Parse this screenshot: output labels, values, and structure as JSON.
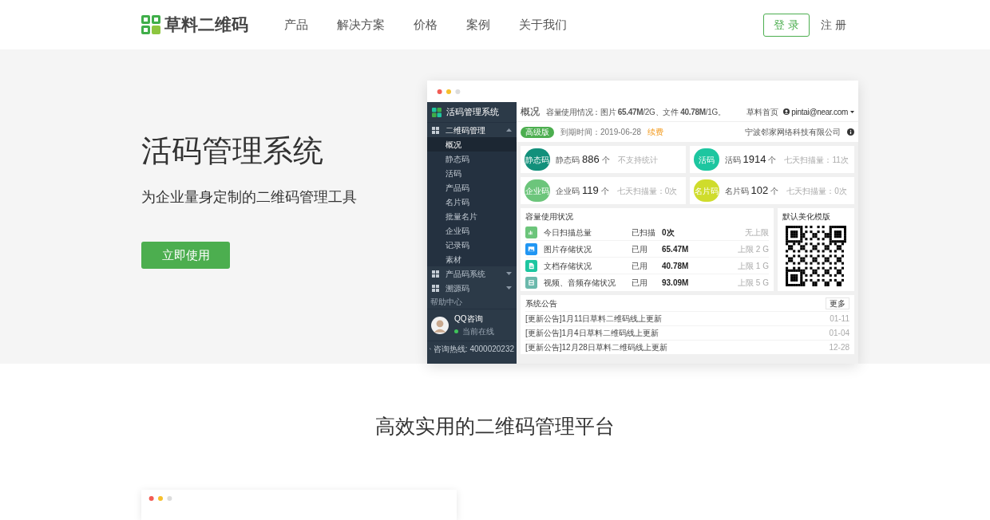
{
  "header": {
    "logo": "草料二维码",
    "nav": [
      {
        "label": "产品"
      },
      {
        "label": "解决方案"
      },
      {
        "label": "价格"
      },
      {
        "label": "案例"
      },
      {
        "label": "关于我们"
      }
    ],
    "login": "登 录",
    "register": "注 册"
  },
  "hero": {
    "title": "活码管理系统",
    "subtitle": "为企业量身定制的二维码管理工具",
    "cta": "立即使用"
  },
  "mockup": {
    "sidebar": {
      "title": "活码管理系统",
      "groups": [
        {
          "label": "二维码管理",
          "expanded": true,
          "children": [
            {
              "label": "概况",
              "selected": true
            },
            {
              "label": "静态码",
              "selected": false
            },
            {
              "label": "活码",
              "selected": false
            },
            {
              "label": "产品码",
              "selected": false
            },
            {
              "label": "名片码",
              "selected": false
            },
            {
              "label": "批量名片",
              "selected": false
            },
            {
              "label": "企业码",
              "selected": false
            },
            {
              "label": "记录码",
              "selected": false
            },
            {
              "label": "素材",
              "selected": false
            }
          ]
        },
        {
          "label": "产品码系统",
          "expanded": false
        },
        {
          "label": "溯源码",
          "expanded": false
        }
      ],
      "help": "帮助中心",
      "contact": {
        "name": "QQ咨询",
        "status": "当前在线",
        "hotline": "咨询热线: 4000020232"
      }
    },
    "topbar": {
      "title": "概况",
      "usage": "容量使用情况：图片 **65.47M**/2G、文件 **40.78M**/1G。",
      "home": "草料首页",
      "user": "pintai@near.com"
    },
    "planbar": {
      "plan": "高级版",
      "expiry": "到期时间：2019-06-28",
      "renew": "续费",
      "company": "宁波邻家网络科技有限公司"
    },
    "stats": [
      {
        "badge": "静态码",
        "label": "静态码",
        "count": "886",
        "unit": "个",
        "note": "不支持统计",
        "color": "#12907b"
      },
      {
        "badge": "活码",
        "label": "活码",
        "count": "1914",
        "unit": "个",
        "note": "七天扫描量：11次",
        "color": "#1dc6a0"
      },
      {
        "badge": "企业码",
        "label": "企业码",
        "count": "119",
        "unit": "个",
        "note": "七天扫描量：0次",
        "color": "#6cc57b"
      },
      {
        "badge": "名片码",
        "label": "名片码",
        "count": "102",
        "unit": "个",
        "note": "七天扫描量：0次",
        "color": "#cfdc2c"
      }
    ],
    "capacity": {
      "title": "容量使用状况",
      "rows": [
        {
          "kind": "chart",
          "label": "今日扫描总量",
          "used": "已扫描",
          "value": "0次",
          "limit": "无上限",
          "color": "#6cc57b"
        },
        {
          "kind": "image",
          "label": "图片存储状况",
          "used": "已用",
          "value": "65.47M",
          "limit": "上限 2 G",
          "color": "#2196f3"
        },
        {
          "kind": "file",
          "label": "文档存储状况",
          "used": "已用",
          "value": "40.78M",
          "limit": "上限 1 G",
          "color": "#1dc6a0"
        },
        {
          "kind": "video",
          "label": "视频、音频存储状况",
          "used": "已用",
          "value": "93.09M",
          "limit": "上限 5 G",
          "color": "#6bb9ac"
        }
      ]
    },
    "template": {
      "title": "默认美化模版"
    },
    "notices": {
      "title": "系统公告",
      "more": "更多",
      "items": [
        {
          "text": "[更新公告]1月11日草料二维码线上更新",
          "date": "01-11"
        },
        {
          "text": "[更新公告]1月4日草料二维码线上更新",
          "date": "01-04"
        },
        {
          "text": "[更新公告]12月28日草料二维码线上更新",
          "date": "12-28"
        }
      ]
    }
  },
  "section": {
    "title": "高效实用的二维码管理平台"
  }
}
